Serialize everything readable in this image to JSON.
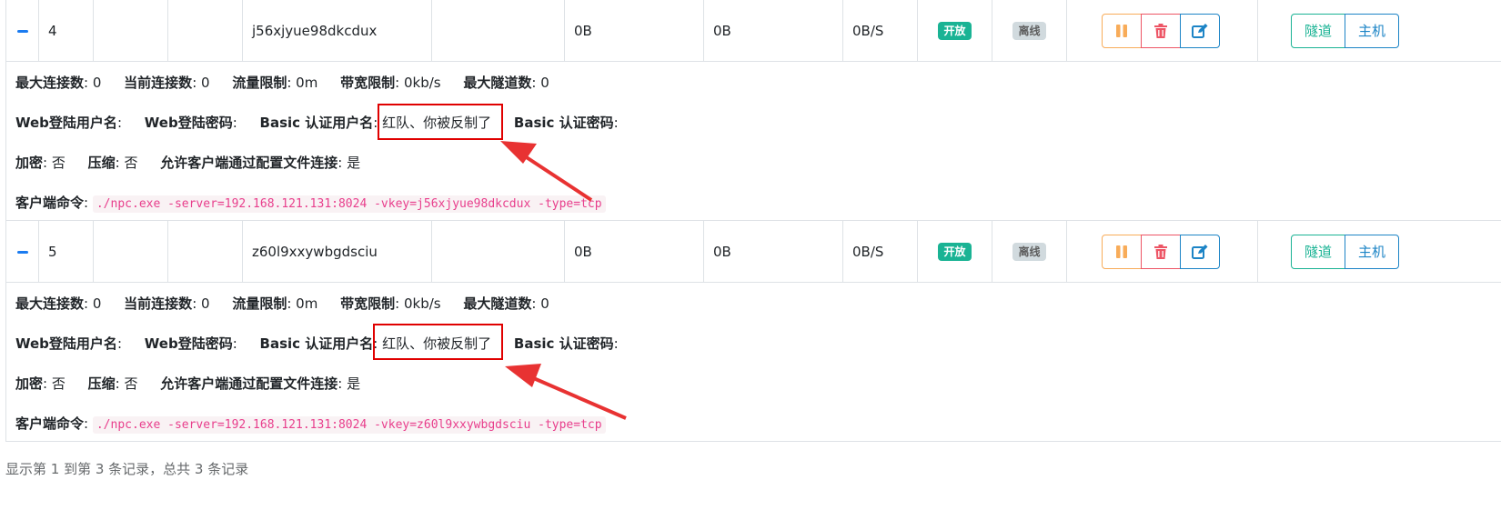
{
  "rows": [
    {
      "id": "4",
      "vkey": "j56xjyue98dkcdux",
      "inflow": "0B",
      "outflow": "0B",
      "speed": "0B/S",
      "status": "开放",
      "connection": "离线",
      "detail": {
        "max_conn_label": "最大连接数",
        "max_conn_value": ": 0",
        "cur_conn_label": "当前连接数",
        "cur_conn_value": ": 0",
        "flow_limit_label": "流量限制",
        "flow_limit_value": ": 0m",
        "rate_limit_label": "带宽限制",
        "rate_limit_value": ": 0kb/s",
        "max_tunnel_label": "最大隧道数",
        "max_tunnel_value": ": 0",
        "web_user_label": "Web登陆用户名",
        "web_user_value": ":",
        "web_pass_label": "Web登陆密码",
        "web_pass_value": ":",
        "basic_user_label": "Basic 认证用户名",
        "basic_user_value": ": 红队、你被反制了",
        "basic_pass_label": "Basic 认证密码",
        "basic_pass_value": ":",
        "crypt_label": "加密",
        "crypt_value": ": 否",
        "compress_label": "压缩",
        "compress_value": ": 否",
        "config_conn_label": "允许客户端通过配置文件连接",
        "config_conn_value": ": 是",
        "cmd_label": "客户端命令",
        "cmd_sep": ":",
        "cmd": "./npc.exe -server=192.168.121.131:8024 -vkey=j56xjyue98dkcdux -type=tcp"
      }
    },
    {
      "id": "5",
      "vkey": "z60l9xxywbgdsciu",
      "inflow": "0B",
      "outflow": "0B",
      "speed": "0B/S",
      "status": "开放",
      "connection": "离线",
      "detail": {
        "max_conn_label": "最大连接数",
        "max_conn_value": ": 0",
        "cur_conn_label": "当前连接数",
        "cur_conn_value": ": 0",
        "flow_limit_label": "流量限制",
        "flow_limit_value": ": 0m",
        "rate_limit_label": "带宽限制",
        "rate_limit_value": ": 0kb/s",
        "max_tunnel_label": "最大隧道数",
        "max_tunnel_value": ": 0",
        "web_user_label": "Web登陆用户名",
        "web_user_value": ":",
        "web_pass_label": "Web登陆密码",
        "web_pass_value": ":",
        "basic_user_label": "Basic 认证用户名",
        "basic_user_value": ": 红队、你被反制了",
        "basic_pass_label": "Basic 认证密码",
        "basic_pass_value": ":",
        "crypt_label": "加密",
        "crypt_value": ": 否",
        "compress_label": "压缩",
        "compress_value": ": 否",
        "config_conn_label": "允许客户端通过配置文件连接",
        "config_conn_value": ": 是",
        "cmd_label": "客户端命令",
        "cmd_sep": ":",
        "cmd": "./npc.exe -server=192.168.121.131:8024 -vkey=z60l9xxywbgdsciu -type=tcp"
      }
    }
  ],
  "buttons": {
    "tunnel": "隧道",
    "host": "主机"
  },
  "icons": {
    "pause": "pause-icon",
    "delete": "trash-icon",
    "edit": "edit-icon",
    "collapse": "minus-icon"
  },
  "colors": {
    "open_badge": "#1ab394",
    "offline_badge": "#d1dade",
    "pause": "#f8ac59",
    "delete": "#ed5565",
    "edit": "#1c84c6",
    "highlight": "#e00000",
    "code_text": "#e83e8c"
  },
  "footer": {
    "summary": "显示第 1 到第 3 条记录，总共 3 条记录"
  }
}
